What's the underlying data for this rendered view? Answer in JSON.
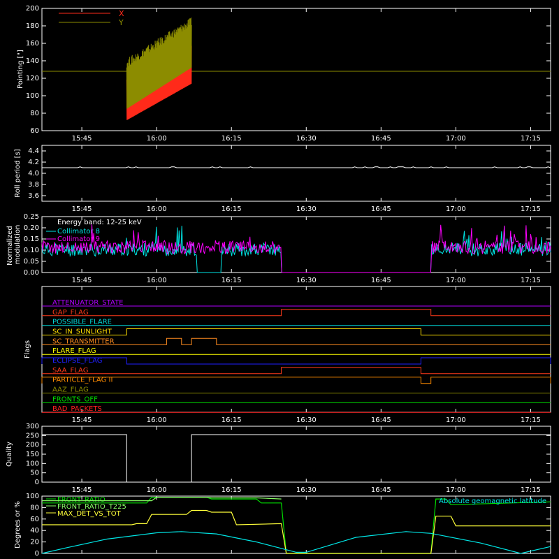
{
  "chart_data": [
    {
      "type": "line",
      "ylabel": "Pointing [\"]",
      "ylim": [
        60,
        200
      ],
      "yticks": [
        60,
        80,
        100,
        120,
        140,
        160,
        180,
        200
      ],
      "xlim": [
        "15:37",
        "17:19"
      ],
      "xticks": [
        "15:45",
        "16:00",
        "16:15",
        "16:30",
        "16:45",
        "17:00",
        "17:15"
      ],
      "legend_position": "top-left",
      "series": [
        {
          "name": "X",
          "color": "#ff2a1a",
          "values": {
            "start": "15:54",
            "end": "16:07",
            "min": 72,
            "max": 165,
            "trend": "rising sawtooth"
          }
        },
        {
          "name": "Y",
          "color": "#8c8c00",
          "values": {
            "start": "15:54",
            "end": "16:07",
            "min": 85,
            "max": 190,
            "trend": "rising sawtooth"
          }
        }
      ],
      "reference_line": {
        "y": 128,
        "color": "#8c8c00"
      }
    },
    {
      "type": "line",
      "ylabel": "Roll period [s]",
      "ylim": [
        3.5,
        4.5
      ],
      "yticks": [
        3.6,
        3.8,
        4.0,
        4.2,
        4.4
      ],
      "series": [
        {
          "color": "#ffffff",
          "values": {
            "level": 4.1,
            "start": "15:37",
            "end": "17:19"
          }
        }
      ]
    },
    {
      "type": "line",
      "ylabel": "Normalized modulation",
      "ylim": [
        0.0,
        0.25
      ],
      "yticks": [
        0.0,
        0.05,
        0.1,
        0.15,
        0.2,
        0.25
      ],
      "annotation": "Energy band: 12-25 keV",
      "legend_position": "top-left",
      "series": [
        {
          "name": "Collimator 8",
          "color": "#00e5e5",
          "segments": [
            [
              "15:37",
              "16:25",
              0.1
            ],
            [
              "16:55",
              "17:19",
              0.1
            ]
          ],
          "gaps": [
            [
              "16:08",
              "16:13"
            ]
          ]
        },
        {
          "name": "Collimator 9",
          "color": "#ff00ff",
          "segments": [
            [
              "15:37",
              "16:25",
              0.11
            ],
            [
              "16:55",
              "17:19",
              0.11
            ]
          ]
        }
      ]
    },
    {
      "type": "table",
      "ylabel": "Flags",
      "flags": [
        {
          "name": "ATTENUATOR_STATE",
          "color": "#b000ff",
          "high_intervals": []
        },
        {
          "name": "GAP_FLAG",
          "color": "#ff3a1a",
          "high_intervals": [
            [
              "16:25",
              "16:55"
            ]
          ]
        },
        {
          "name": "POSSIBLE_FLARE",
          "color": "#00d8d8",
          "high_intervals": []
        },
        {
          "name": "SC_IN_SUNLIGHT",
          "color": "#ffe000",
          "high_intervals": [
            [
              "15:54",
              "16:53"
            ]
          ]
        },
        {
          "name": "SC_TRANSMITTER",
          "color": "#ff8c20",
          "high_intervals": [
            [
              "16:02",
              "16:05"
            ],
            [
              "16:07",
              "16:12"
            ]
          ]
        },
        {
          "name": "FLARE_FLAG",
          "color": "#ffff00",
          "high_intervals": []
        },
        {
          "name": "ECLIPSE_FLAG",
          "color": "#2020ff",
          "high_intervals": [
            [
              "15:37",
              "15:54"
            ],
            [
              "16:53",
              "17:19"
            ]
          ]
        },
        {
          "name": "SAA_FLAG",
          "color": "#ff3a1a",
          "high_intervals": [
            [
              "16:25",
              "16:53"
            ]
          ]
        },
        {
          "name": "PARTICLE_FLAG II",
          "color": "#ff8c00",
          "high_intervals": [
            [
              "15:37",
              "16:53"
            ],
            [
              "16:55",
              "17:19"
            ]
          ]
        },
        {
          "name": "AAZ_FLAG",
          "color": "#8c8c00",
          "high_intervals": []
        },
        {
          "name": "FRONTS_OFF",
          "color": "#00e000",
          "high_intervals": []
        },
        {
          "name": "BAD_PACKETS",
          "color": "#ff2020",
          "high_intervals": []
        }
      ]
    },
    {
      "type": "line",
      "ylabel": "Quality",
      "ylim": [
        0,
        300
      ],
      "yticks": [
        0,
        50,
        100,
        150,
        200,
        250,
        300
      ],
      "series": [
        {
          "color": "#ffffff",
          "points": [
            [
              "15:37",
              255
            ],
            [
              "15:54",
              255
            ],
            [
              "15:54",
              0
            ],
            [
              "16:07",
              0
            ],
            [
              "16:07",
              255
            ],
            [
              "17:19",
              255
            ]
          ]
        }
      ]
    },
    {
      "type": "line",
      "ylabel": "Degrees or %",
      "ylim": [
        0,
        100
      ],
      "yticks": [
        0,
        20,
        40,
        60,
        80,
        100
      ],
      "legend_position": "top-left",
      "series": [
        {
          "name": "FRONT_RATIO",
          "color": "#00e000",
          "points": [
            [
              "15:37",
              88
            ],
            [
              "15:58",
              88
            ],
            [
              "15:59",
              98
            ],
            [
              "16:10",
              98
            ],
            [
              "16:11",
              95
            ],
            [
              "16:20",
              95
            ],
            [
              "16:21",
              88
            ],
            [
              "16:25",
              88
            ],
            [
              "16:26",
              0
            ],
            [
              "16:55",
              0
            ],
            [
              "16:56",
              95
            ],
            [
              "16:58",
              95
            ],
            [
              "16:59",
              85
            ],
            [
              "17:19",
              90
            ]
          ]
        },
        {
          "name": "FRONT_RATIO_T225",
          "color": "#88ff66",
          "points": [
            [
              "15:37",
              92
            ],
            [
              "15:59",
              92
            ],
            [
              "16:00",
              98
            ],
            [
              "16:10",
              98
            ],
            [
              "16:11",
              97
            ],
            [
              "16:20",
              97
            ],
            [
              "16:25",
              95
            ]
          ]
        },
        {
          "name": "MAX_DET_VS_TOT",
          "color": "#ffff3a",
          "points": [
            [
              "15:37",
              50
            ],
            [
              "15:55",
              50
            ],
            [
              "15:56",
              52
            ],
            [
              "15:58",
              52
            ],
            [
              "15:59",
              68
            ],
            [
              "16:06",
              68
            ],
            [
              "16:07",
              75
            ],
            [
              "16:10",
              75
            ],
            [
              "16:11",
              72
            ],
            [
              "16:15",
              72
            ],
            [
              "16:16",
              50
            ],
            [
              "16:25",
              52
            ],
            [
              "16:26",
              0
            ],
            [
              "16:55",
              0
            ],
            [
              "16:56",
              65
            ],
            [
              "16:59",
              65
            ],
            [
              "17:00",
              48
            ],
            [
              "17:19",
              48
            ]
          ]
        },
        {
          "name": "Absolute geomagnetic latitude",
          "color": "#00e5e5",
          "legend_position": "top-right",
          "points": [
            [
              "15:37",
              0
            ],
            [
              "15:42",
              10
            ],
            [
              "15:50",
              25
            ],
            [
              "16:00",
              36
            ],
            [
              "16:05",
              38
            ],
            [
              "16:12",
              34
            ],
            [
              "16:20",
              20
            ],
            [
              "16:28",
              2
            ],
            [
              "16:30",
              2
            ],
            [
              "16:40",
              28
            ],
            [
              "16:50",
              38
            ],
            [
              "16:55",
              35
            ],
            [
              "17:05",
              18
            ],
            [
              "17:13",
              0
            ],
            [
              "17:19",
              12
            ]
          ]
        }
      ]
    }
  ]
}
